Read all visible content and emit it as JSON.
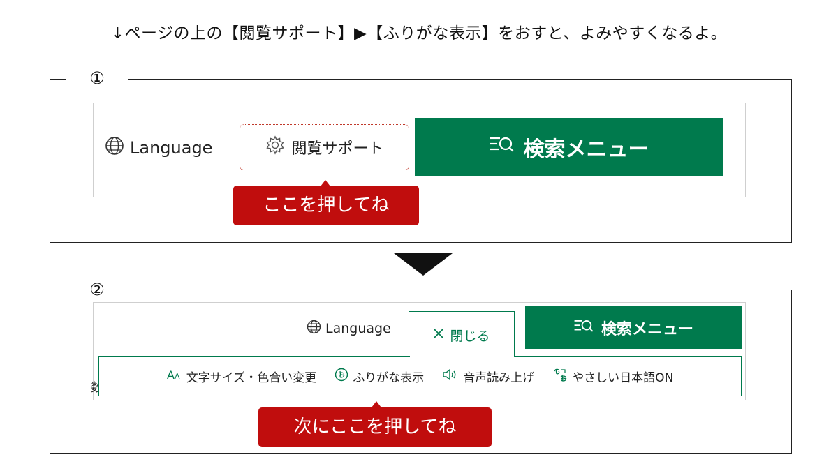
{
  "instruction": "↓ページの上の【閲覧サポート】▶【ふりがな表示】をおすと、よみやすくなるよ。",
  "step1": {
    "label": "①",
    "header": {
      "language_label": "Language",
      "language_icon": "globe-icon",
      "support_label": "閲覧サポート",
      "support_icon": "gear-icon",
      "search_label": "検索メニュー",
      "search_icon": "search-menu-icon"
    },
    "callout": "ここを押してね"
  },
  "step2": {
    "label": "②",
    "header": {
      "language_label": "Language",
      "close_icon": "close-icon",
      "close_label": "閉じる",
      "search_label": "検索メニュー"
    },
    "panel": {
      "items": [
        {
          "icon": "text-size-icon",
          "label": "文字サイズ・色合い変更"
        },
        {
          "icon": "furigana-icon",
          "label": "ふりがな表示"
        },
        {
          "icon": "speaker-icon",
          "label": "音声読み上げ"
        },
        {
          "icon": "easy-japanese-icon",
          "label": "やさしい日本語ON"
        }
      ],
      "cut_char": "数"
    },
    "callout": "次にここを押してね"
  },
  "colors": {
    "brand_green": "#007a4d",
    "callout_red": "#c00d0d",
    "dotted_red": "#c0392b"
  }
}
